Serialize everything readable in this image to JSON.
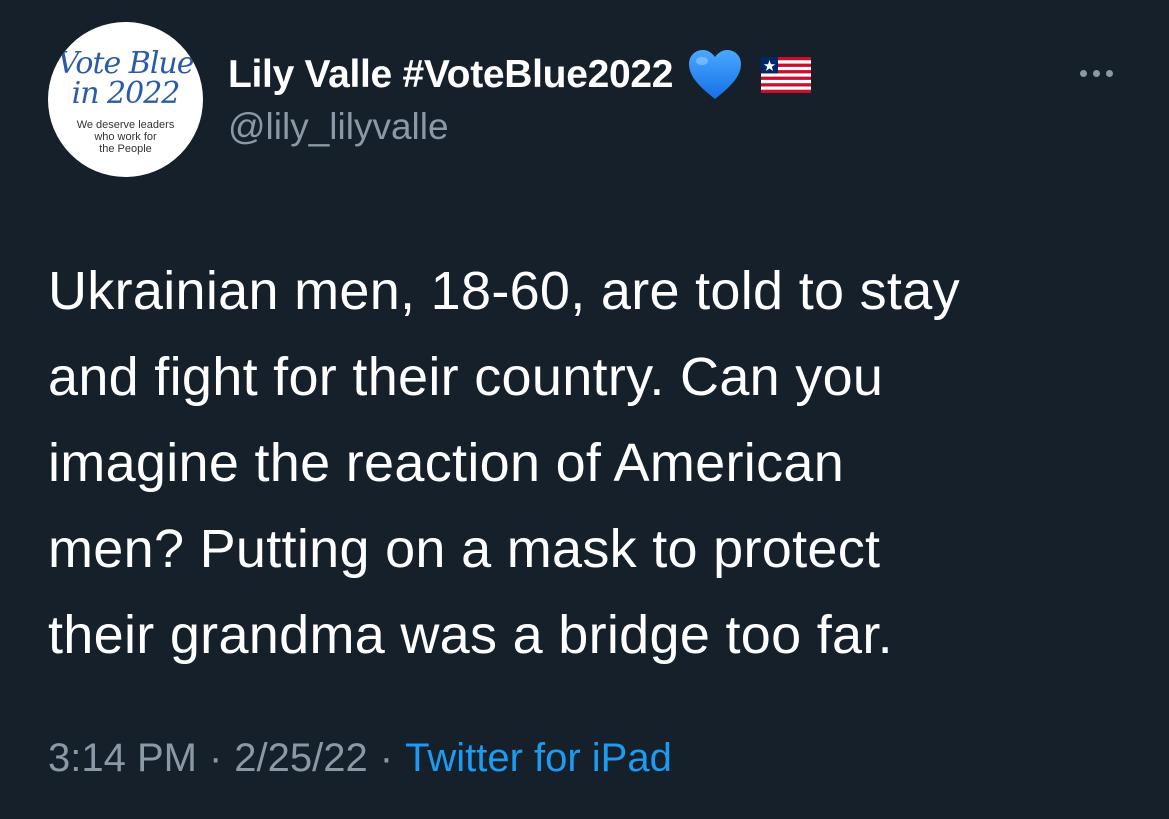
{
  "avatar": {
    "line1": "Vote Blue",
    "line2": "in 2022",
    "sub1": "We deserve leaders",
    "sub2": "who work for",
    "sub3": "the People"
  },
  "author": {
    "display_name": "Lily Valle #VoteBlue2022",
    "handle": "@lily_lilyvalle",
    "badges": [
      "blue-heart-icon",
      "liberia-flag-icon"
    ]
  },
  "tweet": {
    "lines": [
      "Ukrainian men, 18-60, are told to stay",
      "and fight for their country. Can you",
      "imagine the reaction of American",
      "men? Putting on a mask to protect",
      "their grandma was a bridge too far."
    ],
    "time": "3:14 PM",
    "separator": "·",
    "date": "2/25/22",
    "source": "Twitter for iPad"
  },
  "colors": {
    "background": "#15202b",
    "text_primary": "#ffffff",
    "text_secondary": "#8b98a5",
    "link": "#1d9bf0",
    "heart": "#1d8cf8"
  }
}
